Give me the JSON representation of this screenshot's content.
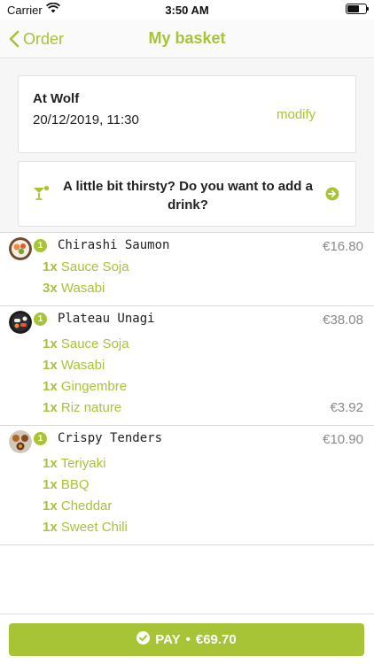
{
  "status_bar": {
    "carrier": "Carrier",
    "time": "3:50 AM"
  },
  "nav": {
    "back_label": "Order",
    "title": "My basket"
  },
  "restaurant": {
    "name": "At Wolf",
    "datetime": "20/12/2019, 11:30",
    "modify_label": "modify"
  },
  "drink_prompt": {
    "text": "A little bit thirsty? Do you want to add a drink?"
  },
  "items": [
    {
      "qty": "1",
      "name": "Chirashi Saumon",
      "price": "€16.80",
      "options": [
        {
          "qty": "1x",
          "name": "Sauce Soja"
        },
        {
          "qty": "3x",
          "name": "Wasabi"
        }
      ]
    },
    {
      "qty": "1",
      "name": "Plateau Unagi",
      "price": "€38.08",
      "options": [
        {
          "qty": "1x",
          "name": "Sauce Soja"
        },
        {
          "qty": "1x",
          "name": "Wasabi"
        },
        {
          "qty": "1x",
          "name": "Gingembre"
        },
        {
          "qty": "1x",
          "name": "Riz nature",
          "price": "€3.92"
        }
      ]
    },
    {
      "qty": "1",
      "name": "Crispy Tenders",
      "price": "€10.90",
      "options": [
        {
          "qty": "1x",
          "name": "Teriyaki"
        },
        {
          "qty": "1x",
          "name": "BBQ"
        },
        {
          "qty": "1x",
          "name": "Cheddar"
        },
        {
          "qty": "1x",
          "name": "Sweet Chili"
        }
      ]
    }
  ],
  "pay": {
    "label": "PAY",
    "separator": "•",
    "total": "€69.70"
  },
  "colors": {
    "accent": "#a7c437",
    "price_grey": "#8a8a8a"
  }
}
